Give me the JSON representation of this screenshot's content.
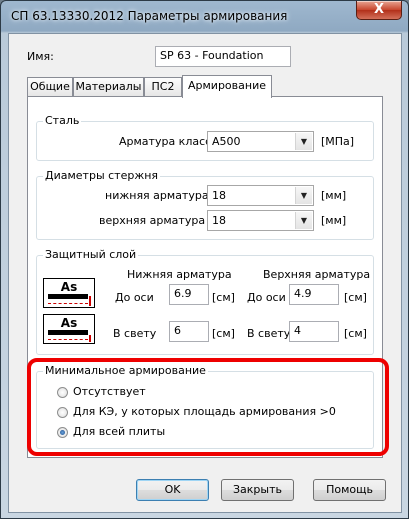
{
  "window": {
    "title": "СП 63.13330.2012 Параметры армирования",
    "close_symbol": "X"
  },
  "name_field": {
    "label": "Имя:",
    "value": "SP 63 - Foundation"
  },
  "tabs": [
    {
      "label": "Общие"
    },
    {
      "label": "Материалы"
    },
    {
      "label": "ПС2"
    },
    {
      "label": "Армирование",
      "active": true
    }
  ],
  "steel": {
    "title": "Сталь",
    "class_label": "Арматура класса",
    "class_value": "A500",
    "unit": "[МПа]"
  },
  "diameters": {
    "title": "Диаметры стержня",
    "bottom_label": "нижняя арматура",
    "bottom_value": "18",
    "top_label": "верхняя арматура",
    "top_value": "18",
    "unit": "[мм]"
  },
  "cover": {
    "title": "Защитный слой",
    "bottom_header": "Нижняя арматура",
    "top_header": "Верхняя арматура",
    "icon_text": "As",
    "to_axis_label": "До оси",
    "clear_label": "В свету",
    "bottom_to_axis": "6.9",
    "top_to_axis": "4.9",
    "bottom_clear": "6",
    "top_clear": "4",
    "unit": "[см]"
  },
  "min_reinforcement": {
    "title": "Минимальное армирование",
    "options": [
      {
        "label": "Отсутствует",
        "checked": false
      },
      {
        "label": "Для КЭ, у которых площадь армирования >0",
        "checked": false
      },
      {
        "label": "Для всей плиты",
        "checked": true
      }
    ]
  },
  "buttons": {
    "ok": "OK",
    "close": "Закрыть",
    "help": "Помощь"
  },
  "colors": {
    "highlight": "#ee0000",
    "title_bar": "#9fb8cf",
    "close_button": "#c7452c"
  }
}
